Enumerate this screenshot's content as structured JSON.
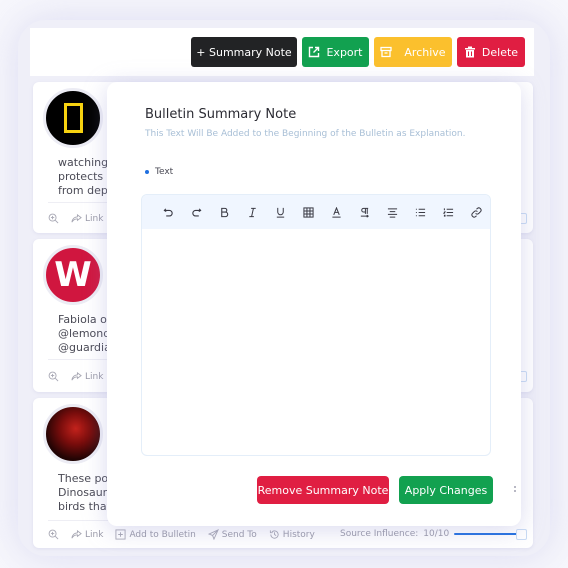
{
  "toolbar": {
    "summary_note_label": "+ Summary Note",
    "export_label": "Export",
    "archive_label": "Archive",
    "delete_label": "Delete",
    "colors": {
      "summary_note": "#222325",
      "export": "#12a150",
      "archive": "#fbc02d",
      "delete": "#e01e42"
    }
  },
  "cards": [
    {
      "avatar": "national-geographic-logo",
      "text_lines": [
        "watching fi",
        "protects sc",
        "from depor"
      ],
      "actions": {
        "zoom": "zoom-in-icon",
        "link": "Link"
      }
    },
    {
      "avatar": "W",
      "text_lines": [
        "Fabiola oft",
        "@lemonde",
        "@guardian"
      ],
      "actions": {
        "zoom": "zoom-in-icon",
        "link": "Link"
      }
    },
    {
      "avatar": "person-photo",
      "text_lines": [
        "These port",
        "Dinosaurs",
        "birds that s"
      ],
      "actions": {
        "zoom": "zoom-in-icon",
        "link": "Link",
        "add_to_bulletin": "Add to Bulletin",
        "send_to": "Send To",
        "history": "History"
      },
      "influence_label": "Source Influence:",
      "influence_value": "10/10",
      "influence_fraction": 1.0
    }
  ],
  "modal": {
    "title": "Bulletin Summary Note",
    "subtitle": "This Text Will Be Added to the Beginning of the Bulletin as Explanation.",
    "field_label": "Text",
    "editor_value": "",
    "editor_tools": [
      "undo",
      "redo",
      "bold",
      "italic",
      "underline",
      "table",
      "font-color",
      "paragraph-direction",
      "align-center",
      "bullet-list",
      "numbered-list",
      "link"
    ],
    "remove_label": "Remove Summary Note",
    "apply_label": "Apply Changes",
    "accent_color": "#1f6fe0"
  }
}
